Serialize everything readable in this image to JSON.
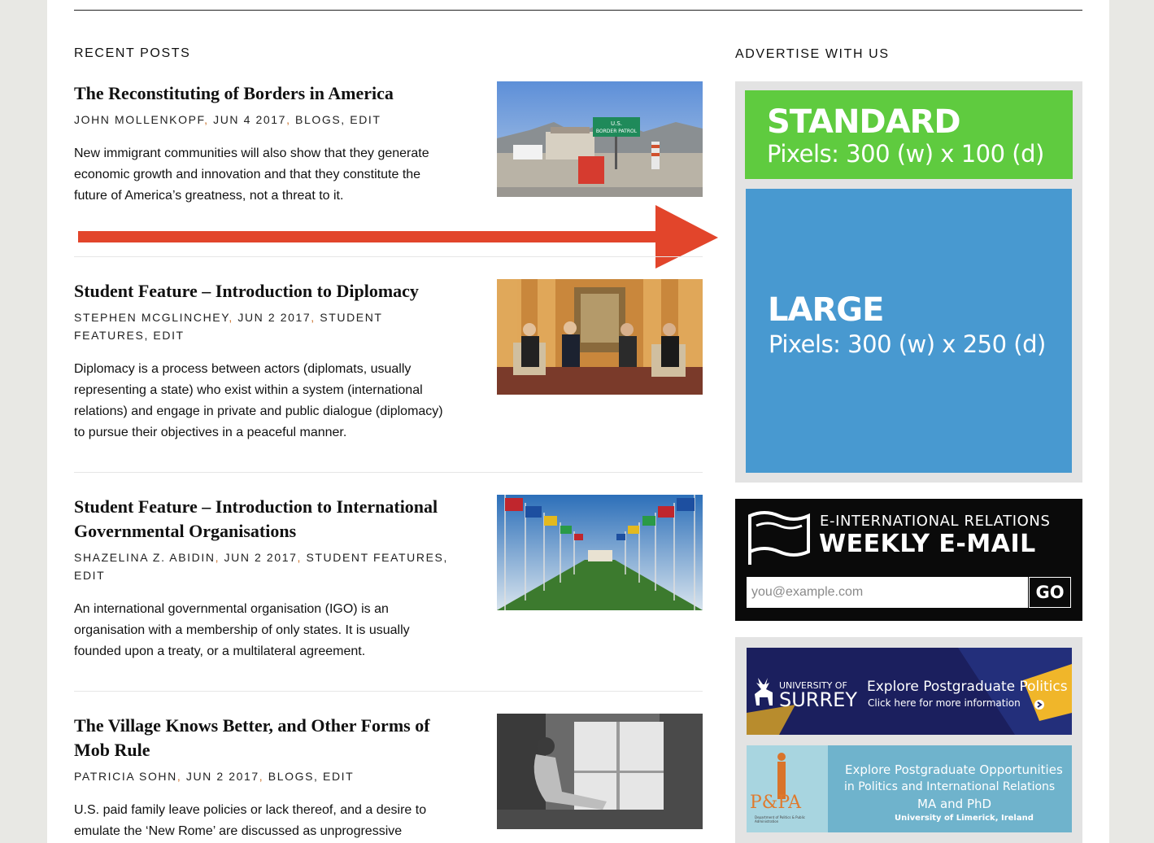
{
  "recent_posts": {
    "heading": "RECENT POSTS",
    "posts": [
      {
        "title": "The Reconstituting of Borders in America",
        "author": "JOHN MOLLENKOPF",
        "date": "JUN 4 2017",
        "category": "BLOGS",
        "edit": "EDIT",
        "excerpt": "New immigrant communities will also show that they generate economic growth and innovation and that they constitute the future of America’s greatness, not a threat to it.",
        "thumb_sign": "U.S. BORDER PATROL"
      },
      {
        "title": "Student Feature – Introduction to Diplomacy",
        "author": "STEPHEN MCGLINCHEY",
        "date": "JUN 2 2017",
        "category": "STUDENT FEATURES",
        "edit": "EDIT",
        "excerpt": "Diplomacy is a process between actors (diplomats, usually representing a state) who exist within a system (international relations) and engage in private and public dialogue (diplomacy) to pursue their objectives in a peaceful manner."
      },
      {
        "title": "Student Feature – Introduction to International Governmental Organisations",
        "author": "SHAZELINA Z. ABIDIN",
        "date": "JUN 2 2017",
        "category": "STUDENT FEATURES",
        "edit": "EDIT",
        "excerpt": "An international governmental organisation (IGO) is an organisation with a membership of only states. It is usually founded upon a treaty, or a multilateral agreement."
      },
      {
        "title": "The Village Knows Better, and Other Forms of Mob Rule",
        "author": "PATRICIA SOHN",
        "date": "JUN 2 2017",
        "category": "BLOGS",
        "edit": "EDIT",
        "excerpt": "U.S. paid family leave policies or lack thereof, and a desire to emulate the ‘New Rome’ are discussed as unprogressive"
      }
    ]
  },
  "sidebar": {
    "heading": "ADVERTISE WITH US",
    "standard": {
      "title": "STANDARD",
      "sub": "Pixels: 300 (w) x 100 (d)"
    },
    "large": {
      "title": "LARGE",
      "sub": "Pixels: 300 (w) x 250 (d)"
    },
    "newsletter": {
      "line1": "E-INTERNATIONAL RELATIONS",
      "line2": "WEEKLY E-MAIL",
      "placeholder": "you@example.com",
      "button": "GO"
    },
    "banner_surrey": {
      "logo_line1": "UNIVERSITY OF",
      "logo_line2": "SURREY",
      "headline": "Explore Postgraduate Politics",
      "cta": "Click here for more information"
    },
    "banner_limerick": {
      "logo": "P&PA",
      "logo_small": "Department of Politics & Public Administration",
      "line1": "Explore Postgraduate Opportunities",
      "line2": "in Politics and International Relations",
      "line3": "MA and PhD",
      "line4": "University of Limerick, Ireland"
    }
  },
  "colors": {
    "standard_ad": "#5fcb3f",
    "large_ad": "#4899d0",
    "arrow": "#e2452b",
    "meta_separator": "#c8702a"
  }
}
